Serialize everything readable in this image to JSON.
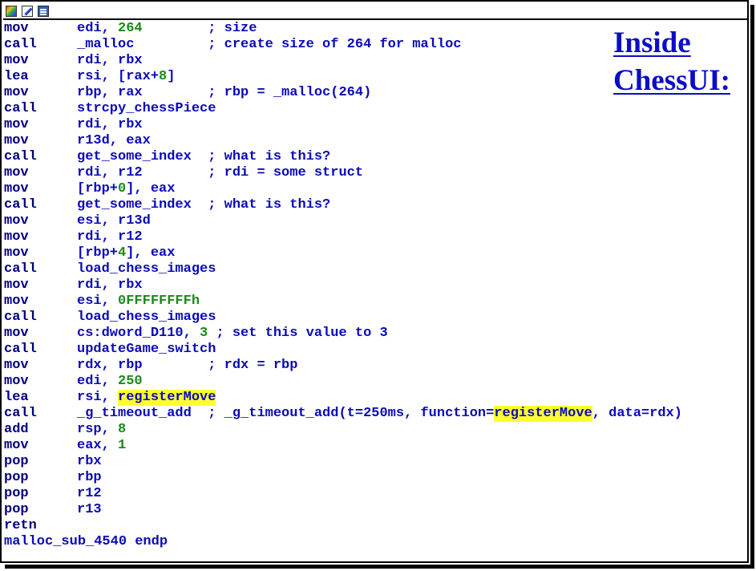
{
  "toolbar": {
    "icons": [
      "graph-view-icon",
      "edit-icon",
      "text-view-icon"
    ]
  },
  "title": {
    "line1": "Inside",
    "line2": "ChessUI:"
  },
  "colors": {
    "mnemonic": "#000080",
    "operand": "#0a0ab8",
    "number": "#1a8a1a",
    "highlight": "#ffff30",
    "title": "#0c0cc8"
  },
  "code": [
    [
      [
        "mn",
        "mov"
      ],
      [
        "t",
        "edi, "
      ],
      [
        "num",
        "264"
      ],
      [
        "t",
        "        "
      ],
      [
        "cmt",
        "; size"
      ]
    ],
    [
      [
        "mn",
        "call"
      ],
      [
        "t",
        "_malloc         "
      ],
      [
        "cmt",
        "; create size of 264 for malloc"
      ]
    ],
    [
      [
        "mn",
        "mov"
      ],
      [
        "t",
        "rdi, rbx"
      ]
    ],
    [
      [
        "mn",
        "lea"
      ],
      [
        "t",
        "rsi, [rax+"
      ],
      [
        "num",
        "8"
      ],
      [
        "t",
        "]"
      ]
    ],
    [
      [
        "mn",
        "mov"
      ],
      [
        "t",
        "rbp, rax        "
      ],
      [
        "cmt",
        "; rbp = _malloc(264)"
      ]
    ],
    [
      [
        "mn",
        "call"
      ],
      [
        "t",
        "strcpy_chessPiece"
      ]
    ],
    [
      [
        "mn",
        "mov"
      ],
      [
        "t",
        "rdi, rbx"
      ]
    ],
    [
      [
        "mn",
        "mov"
      ],
      [
        "t",
        "r13d, eax"
      ]
    ],
    [
      [
        "mn",
        "call"
      ],
      [
        "t",
        "get_some_index  "
      ],
      [
        "cmt",
        "; what is this?"
      ]
    ],
    [
      [
        "mn",
        "mov"
      ],
      [
        "t",
        "rdi, r12        "
      ],
      [
        "cmt",
        "; rdi = some struct"
      ]
    ],
    [
      [
        "mn",
        "mov"
      ],
      [
        "t",
        "[rbp+"
      ],
      [
        "num",
        "0"
      ],
      [
        "t",
        "], eax"
      ]
    ],
    [
      [
        "mn",
        "call"
      ],
      [
        "t",
        "get_some_index  "
      ],
      [
        "cmt",
        "; what is this?"
      ]
    ],
    [
      [
        "mn",
        "mov"
      ],
      [
        "t",
        "esi, r13d"
      ]
    ],
    [
      [
        "mn",
        "mov"
      ],
      [
        "t",
        "rdi, r12"
      ]
    ],
    [
      [
        "mn",
        "mov"
      ],
      [
        "t",
        "[rbp+"
      ],
      [
        "num",
        "4"
      ],
      [
        "t",
        "], eax"
      ]
    ],
    [
      [
        "mn",
        "call"
      ],
      [
        "t",
        "load_chess_images"
      ]
    ],
    [
      [
        "mn",
        "mov"
      ],
      [
        "t",
        "rdi, rbx"
      ]
    ],
    [
      [
        "mn",
        "mov"
      ],
      [
        "t",
        "esi, "
      ],
      [
        "num",
        "0FFFFFFFFh"
      ]
    ],
    [
      [
        "mn",
        "call"
      ],
      [
        "t",
        "load_chess_images"
      ]
    ],
    [
      [
        "mn",
        "mov"
      ],
      [
        "t",
        "cs:dword_D110, "
      ],
      [
        "num",
        "3"
      ],
      [
        "t",
        " "
      ],
      [
        "cmt",
        "; set this value to 3"
      ]
    ],
    [
      [
        "mn",
        "call"
      ],
      [
        "t",
        "updateGame_switch"
      ]
    ],
    [
      [
        "mn",
        "mov"
      ],
      [
        "t",
        "rdx, rbp        "
      ],
      [
        "cmt",
        "; rdx = rbp"
      ]
    ],
    [
      [
        "mn",
        "mov"
      ],
      [
        "t",
        "edi, "
      ],
      [
        "num",
        "250"
      ]
    ],
    [
      [
        "mn",
        "lea"
      ],
      [
        "t",
        "rsi, "
      ],
      [
        "hl",
        "registerMove"
      ]
    ],
    [
      [
        "mn",
        "call"
      ],
      [
        "t",
        "_g_timeout_add  "
      ],
      [
        "cmt",
        "; _g_timeout_add(t=250ms, function="
      ],
      [
        "hl",
        "registerMove"
      ],
      [
        "cmt",
        ", data=rdx)"
      ]
    ],
    [
      [
        "mn",
        "add"
      ],
      [
        "t",
        "rsp, "
      ],
      [
        "num",
        "8"
      ]
    ],
    [
      [
        "mn",
        "mov"
      ],
      [
        "t",
        "eax, "
      ],
      [
        "num",
        "1"
      ]
    ],
    [
      [
        "mn",
        "pop"
      ],
      [
        "t",
        "rbx"
      ]
    ],
    [
      [
        "mn",
        "pop"
      ],
      [
        "t",
        "rbp"
      ]
    ],
    [
      [
        "mn",
        "pop"
      ],
      [
        "t",
        "r12"
      ]
    ],
    [
      [
        "mn",
        "pop"
      ],
      [
        "t",
        "r13"
      ]
    ],
    [
      [
        "mn",
        "retn"
      ]
    ],
    [
      [
        "t",
        "malloc_sub_4540 endp"
      ]
    ]
  ]
}
